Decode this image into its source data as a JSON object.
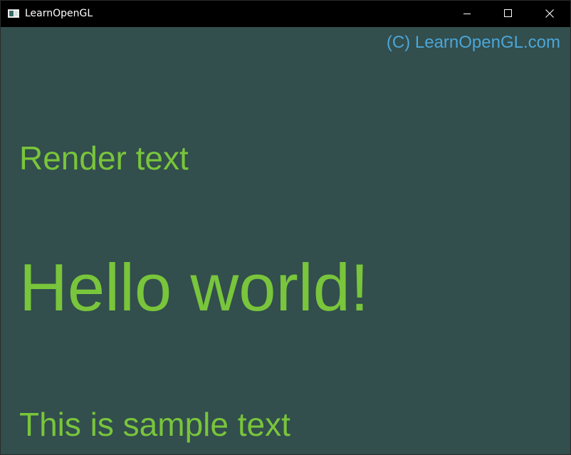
{
  "window": {
    "title": "LearnOpenGL",
    "icon": "window-app-icon",
    "controls": {
      "minimize_icon": "minimize-icon",
      "maximize_icon": "maximize-icon",
      "close_icon": "close-icon"
    }
  },
  "viewport": {
    "background_color": "#324e4d",
    "texts": {
      "copyright": "(C) LearnOpenGL.com",
      "render_label": "Render text",
      "hello": "Hello world!",
      "sample": "This is sample text"
    },
    "colors": {
      "copyright": "#4ba6d8",
      "primary_text": "#79c53b"
    }
  }
}
